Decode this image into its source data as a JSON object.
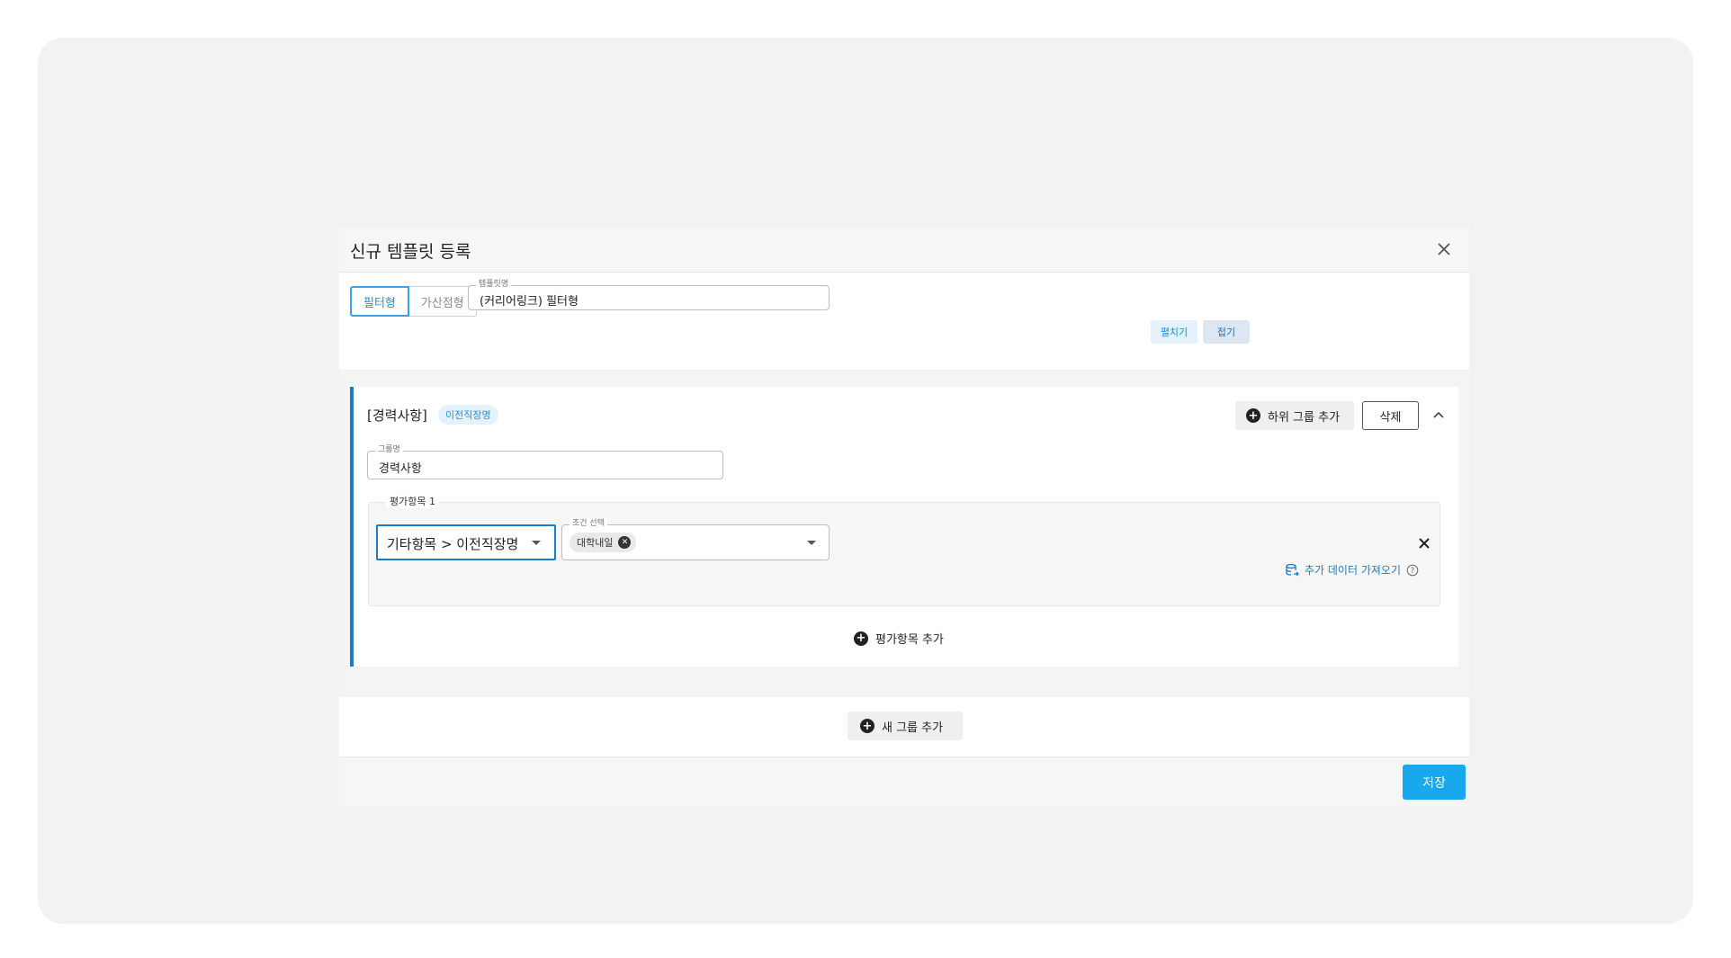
{
  "modal": {
    "title": "신규 템플릿 등록",
    "type_options": [
      "필터형",
      "가산점형"
    ],
    "template_name": {
      "label": "템플릿명",
      "value": "(커리어링크) 필터형"
    },
    "expand_label": "펼치기",
    "collapse_label": "접기"
  },
  "group": {
    "title": "[경력사항]",
    "chip": "이전직장명",
    "add_subgroup_label": "하위 그룹 추가",
    "delete_label": "삭제",
    "group_name": {
      "label": "그룹명",
      "value": "경력사항"
    },
    "eval_item": {
      "label": "평가항목 1",
      "item_select": "기타항목 > 이전직장명",
      "condition": {
        "label": "조건 선택",
        "tag": "대학내일"
      },
      "import_label": "추가 데이터 가져오기"
    },
    "add_eval_label": "평가항목 추가"
  },
  "new_group_label": "새 그룹 추가",
  "save_label": "저장",
  "colors": {
    "accent": "#1a7cc8",
    "save": "#18a9ec",
    "chip_bg": "#e4f2fc"
  }
}
